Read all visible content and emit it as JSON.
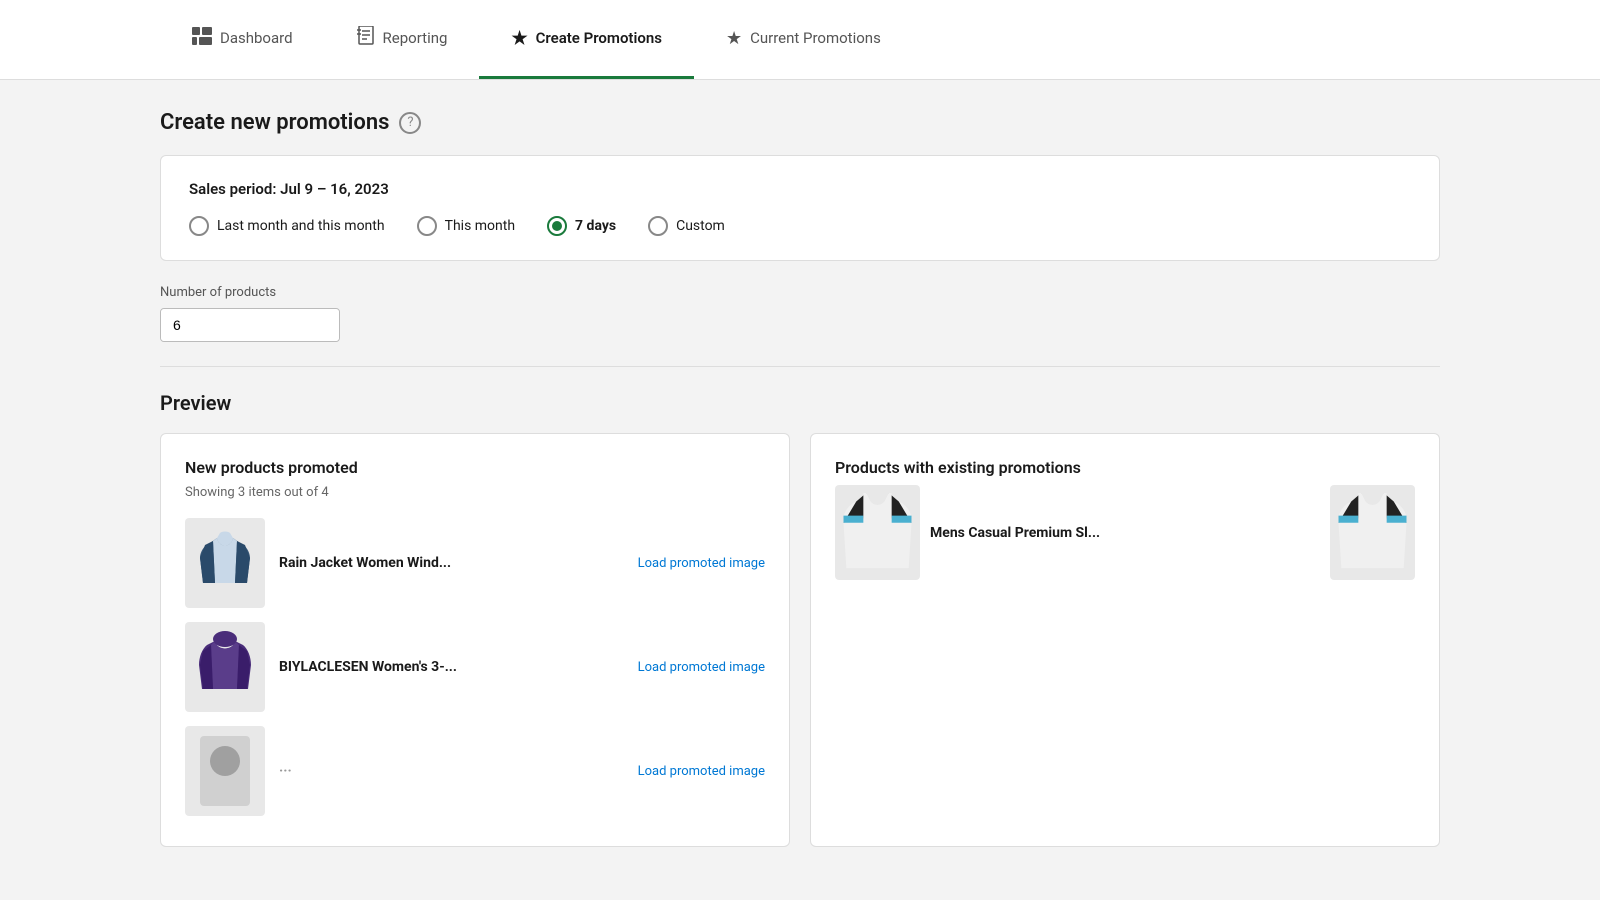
{
  "nav": {
    "items": [
      {
        "id": "dashboard",
        "label": "Dashboard",
        "icon": "🖥",
        "active": false
      },
      {
        "id": "reporting",
        "label": "Reporting",
        "icon": "📋",
        "active": false
      },
      {
        "id": "create-promotions",
        "label": "Create Promotions",
        "icon": "★",
        "active": true
      },
      {
        "id": "current-promotions",
        "label": "Current Promotions",
        "icon": "★",
        "active": false
      }
    ]
  },
  "page": {
    "title": "Create new promotions",
    "help_icon": "?"
  },
  "sales_period": {
    "label": "Sales period: Jul 9 – 16, 2023",
    "options": [
      {
        "id": "last-month",
        "label": "Last month and this month",
        "selected": false
      },
      {
        "id": "this-month",
        "label": "This month",
        "selected": false
      },
      {
        "id": "7-days",
        "label": "7 days",
        "selected": true
      },
      {
        "id": "custom",
        "label": "Custom",
        "selected": false
      }
    ]
  },
  "number_of_products": {
    "label": "Number of products",
    "value": "6"
  },
  "preview": {
    "title": "Preview",
    "new_products": {
      "title": "New products promoted",
      "subtitle": "Showing 3 items out of 4",
      "items": [
        {
          "name": "Rain Jacket Women Wind...",
          "link": "Load promoted image"
        },
        {
          "name": "BIYLACLESEN Women's 3-...",
          "link": "Load promoted image"
        },
        {
          "name": "...",
          "link": "Load promoted image"
        }
      ]
    },
    "existing_products": {
      "title": "Products with existing promotions",
      "items": [
        {
          "name": "Mens Casual Premium Sl..."
        }
      ]
    }
  }
}
